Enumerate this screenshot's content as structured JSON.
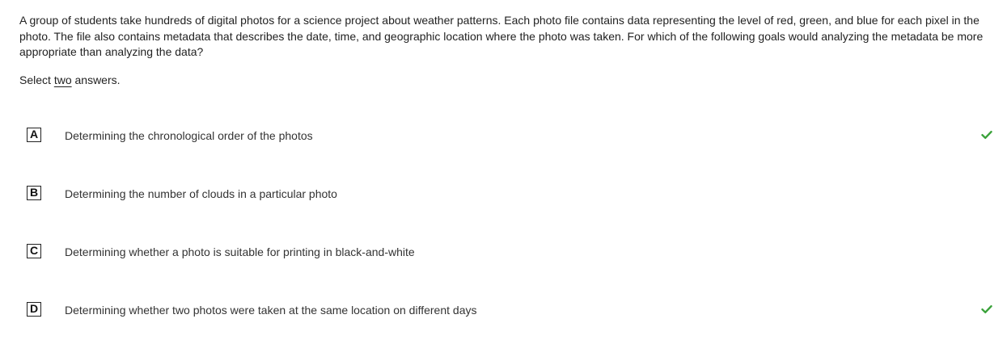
{
  "question": {
    "prompt": "A group of students take hundreds of digital photos for a science project about weather patterns. Each photo file contains data representing the level of red, green, and blue for each pixel in the photo. The file also contains metadata that describes the date, time, and geographic location where the photo was taken. For which of the following goals would analyzing the metadata be more appropriate than analyzing the data?",
    "instruction_prefix": "Select ",
    "instruction_count": "two",
    "instruction_suffix": " answers."
  },
  "choices": [
    {
      "letter": "A",
      "text": "Determining the chronological order of the photos",
      "correct": true
    },
    {
      "letter": "B",
      "text": "Determining the number of clouds in a particular photo",
      "correct": false
    },
    {
      "letter": "C",
      "text": "Determining whether a photo is suitable for printing in black-and-white",
      "correct": false
    },
    {
      "letter": "D",
      "text": "Determining whether two photos were taken at the same location on different days",
      "correct": true
    }
  ],
  "colors": {
    "check": "#3aa23a",
    "text": "#333333",
    "box_border": "#222222"
  },
  "icons": {
    "correct": "checkmark-icon"
  }
}
